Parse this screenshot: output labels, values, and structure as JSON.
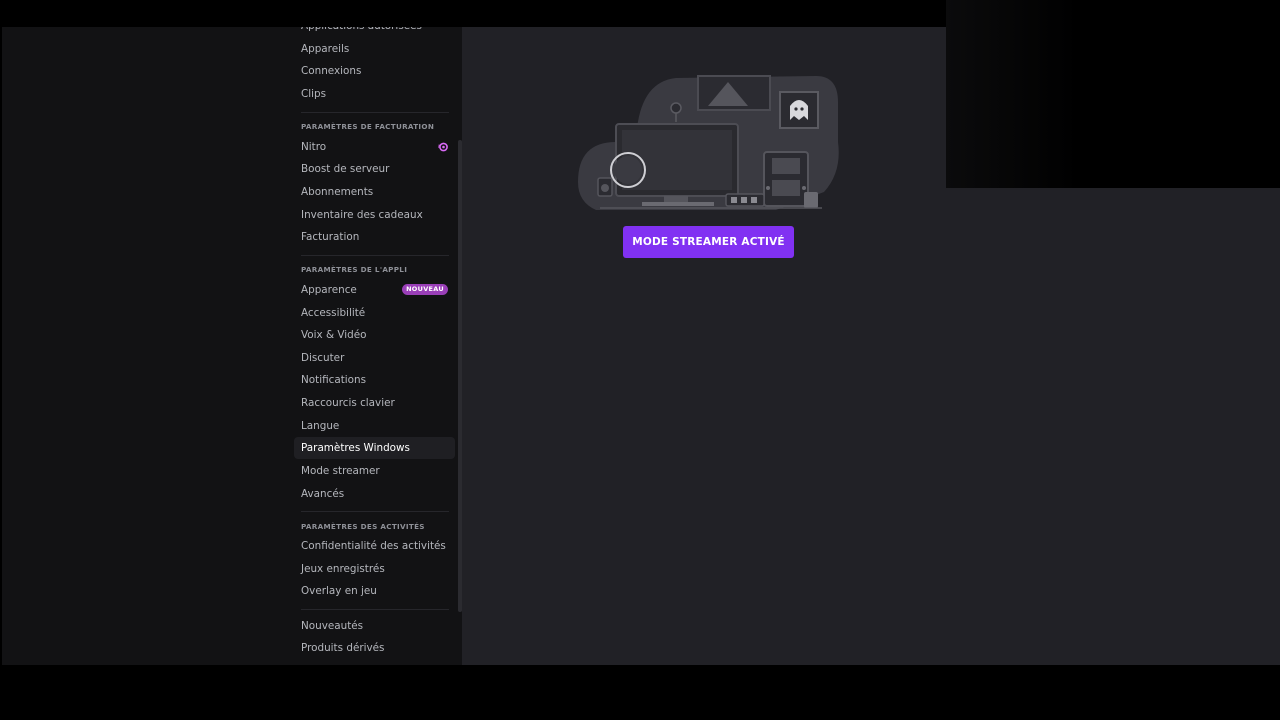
{
  "sidebar": {
    "top_items": [
      {
        "id": "applications",
        "label": "Applications autorisées"
      },
      {
        "id": "devices",
        "label": "Appareils"
      },
      {
        "id": "connections",
        "label": "Connexions"
      },
      {
        "id": "clips",
        "label": "Clips"
      }
    ],
    "billing_header": "PARAMÈTRES DE FACTURATION",
    "billing_items": [
      {
        "id": "nitro",
        "label": "Nitro"
      },
      {
        "id": "server-boost",
        "label": "Boost de serveur"
      },
      {
        "id": "subscriptions",
        "label": "Abonnements"
      },
      {
        "id": "gift-inventory",
        "label": "Inventaire des cadeaux"
      },
      {
        "id": "billing",
        "label": "Facturation"
      }
    ],
    "app_header": "PARAMÈTRES DE L'APPLI",
    "app_items": [
      {
        "id": "appearance",
        "label": "Apparence",
        "badge": "NOUVEAU"
      },
      {
        "id": "accessibility",
        "label": "Accessibilité"
      },
      {
        "id": "voice-video",
        "label": "Voix & Vidéo"
      },
      {
        "id": "chat",
        "label": "Discuter"
      },
      {
        "id": "notifications",
        "label": "Notifications"
      },
      {
        "id": "keybinds",
        "label": "Raccourcis clavier"
      },
      {
        "id": "language",
        "label": "Langue"
      },
      {
        "id": "windows-settings",
        "label": "Paramètres Windows",
        "selected": true
      },
      {
        "id": "streamer-mode",
        "label": "Mode streamer"
      },
      {
        "id": "advanced",
        "label": "Avancés"
      }
    ],
    "activity_header": "PARAMÈTRES DES ACTIVITÉS",
    "activity_items": [
      {
        "id": "activity-privacy",
        "label": "Confidentialité des activités"
      },
      {
        "id": "registered-games",
        "label": "Jeux enregistrés"
      },
      {
        "id": "game-overlay",
        "label": "Overlay en jeu"
      }
    ],
    "other_items": [
      {
        "id": "whats-new",
        "label": "Nouveautés"
      },
      {
        "id": "merch",
        "label": "Produits dérivés"
      }
    ]
  },
  "main": {
    "streamer_button_label": "MODE STREAMER ACTIVÉ"
  },
  "colors": {
    "accent": "#8131f2",
    "badge": "#9a3fb8",
    "nitro": "#d96af5",
    "sidebar_bg": "#121214",
    "content_bg": "#212126"
  }
}
